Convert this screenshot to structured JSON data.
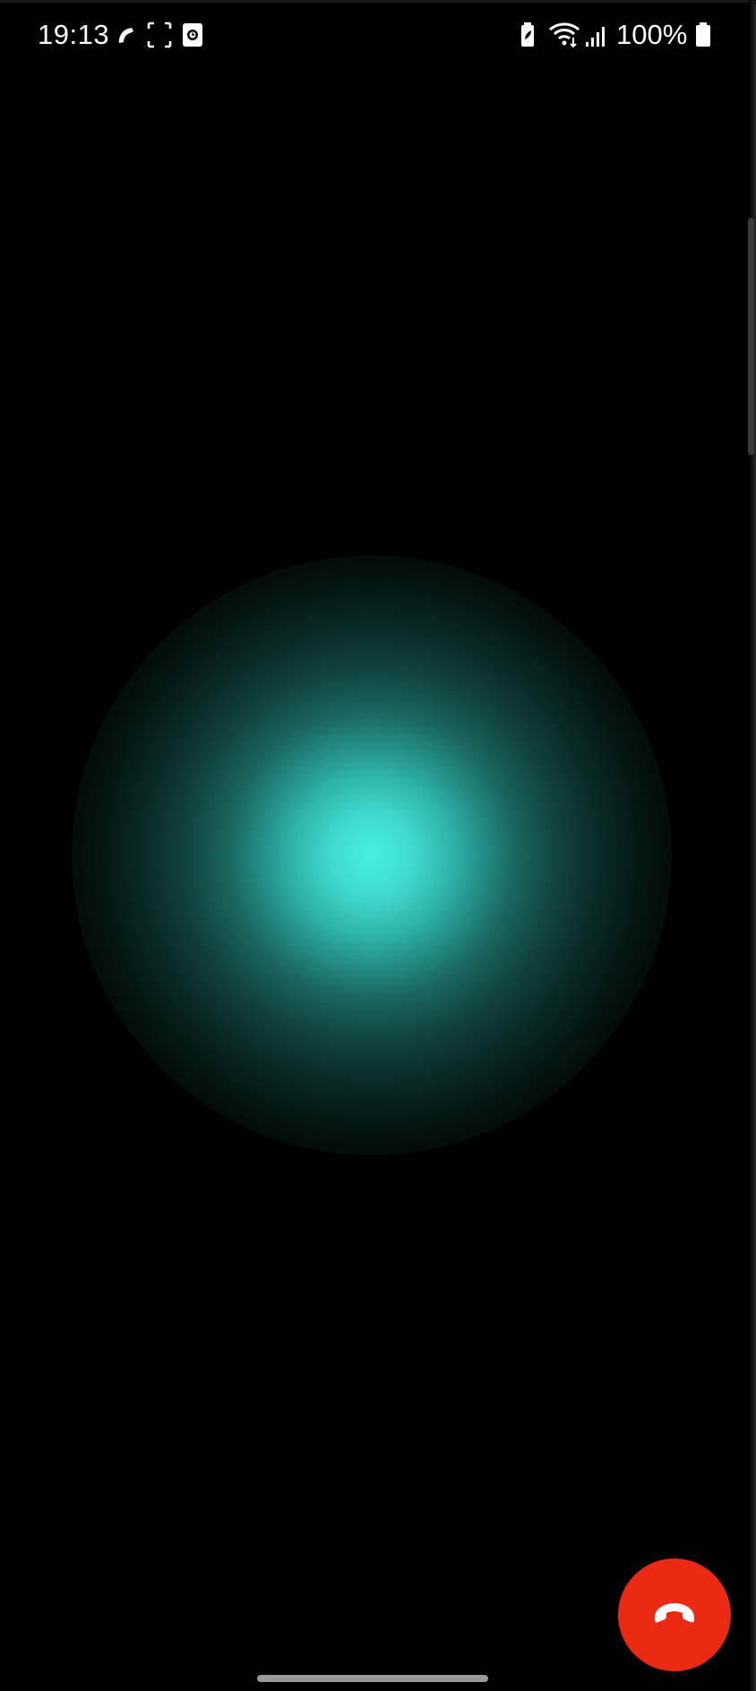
{
  "status_bar": {
    "time": "19:13",
    "battery_text": "100%",
    "icons": [
      "phone-call-icon",
      "screen-capture-icon",
      "screen-recorder-icon",
      "battery-saver-icon",
      "wifi-icon",
      "signal-icon",
      "battery-icon"
    ]
  },
  "orb": {
    "color_center": "#47f0e3",
    "color_edge": "#000000"
  },
  "end_call": {
    "icon": "end-call-icon",
    "color": "#ea2a12"
  }
}
